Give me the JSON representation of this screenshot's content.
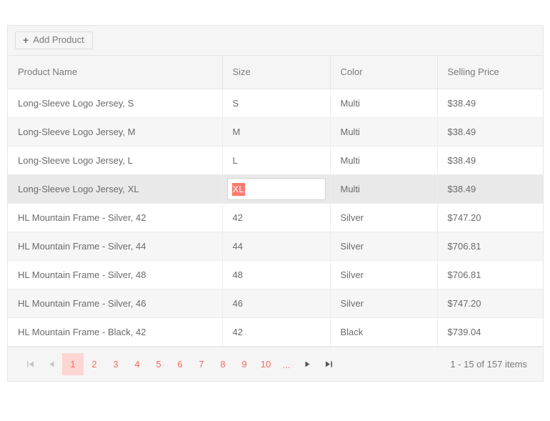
{
  "toolbar": {
    "add_product_label": "Add Product",
    "add_icon": "plus-icon"
  },
  "grid": {
    "columns": [
      {
        "key": "product_name",
        "label": "Product Name"
      },
      {
        "key": "size",
        "label": "Size"
      },
      {
        "key": "color",
        "label": "Color"
      },
      {
        "key": "selling_price",
        "label": "Selling Price"
      }
    ],
    "rows": [
      {
        "product_name": "Long-Sleeve Logo Jersey, S",
        "size": "S",
        "color": "Multi",
        "selling_price": "$38.49",
        "selected": false,
        "editing": false
      },
      {
        "product_name": "Long-Sleeve Logo Jersey, M",
        "size": "M",
        "color": "Multi",
        "selling_price": "$38.49",
        "selected": false,
        "editing": false
      },
      {
        "product_name": "Long-Sleeve Logo Jersey, L",
        "size": "L",
        "color": "Multi",
        "selling_price": "$38.49",
        "selected": false,
        "editing": false
      },
      {
        "product_name": "Long-Sleeve Logo Jersey, XL",
        "size": "XL",
        "color": "Multi",
        "selling_price": "$38.49",
        "selected": true,
        "editing": true
      },
      {
        "product_name": "HL Mountain Frame - Silver, 42",
        "size": "42",
        "color": "Silver",
        "selling_price": "$747.20",
        "selected": false,
        "editing": false
      },
      {
        "product_name": "HL Mountain Frame - Silver, 44",
        "size": "44",
        "color": "Silver",
        "selling_price": "$706.81",
        "selected": false,
        "editing": false
      },
      {
        "product_name": "HL Mountain Frame - Silver, 48",
        "size": "48",
        "color": "Silver",
        "selling_price": "$706.81",
        "selected": false,
        "editing": false
      },
      {
        "product_name": "HL Mountain Frame - Silver, 46",
        "size": "46",
        "color": "Silver",
        "selling_price": "$747.20",
        "selected": false,
        "editing": false
      },
      {
        "product_name": "HL Mountain Frame - Black, 42",
        "size": "42",
        "color": "Black",
        "selling_price": "$739.04",
        "selected": false,
        "editing": false
      }
    ],
    "editor": {
      "value": "XL",
      "selected_text": "XL",
      "selection_color": "#fb7a6f",
      "selection_text_color": "#ffffff"
    }
  },
  "pager": {
    "first_icon": "first-page-icon",
    "prev_icon": "previous-page-icon",
    "next_icon": "next-page-icon",
    "last_icon": "last-page-icon",
    "first_enabled": false,
    "prev_enabled": false,
    "next_enabled": true,
    "last_enabled": true,
    "pages": [
      "1",
      "2",
      "3",
      "4",
      "5",
      "6",
      "7",
      "8",
      "9",
      "10"
    ],
    "ellipsis": "...",
    "current_page": "1",
    "info": "1 - 15 of 157 items"
  },
  "colors": {
    "accent": "#f96a5f",
    "accent_active_bg": "#fcd6d2",
    "selection_highlight": "#fb7a6f",
    "header_bg": "#f5f5f5",
    "row_alt_bg": "#f6f6f6",
    "row_selected_bg": "#e9e9e9",
    "border": "#e6e6e6",
    "text": "#6b6b6b"
  }
}
